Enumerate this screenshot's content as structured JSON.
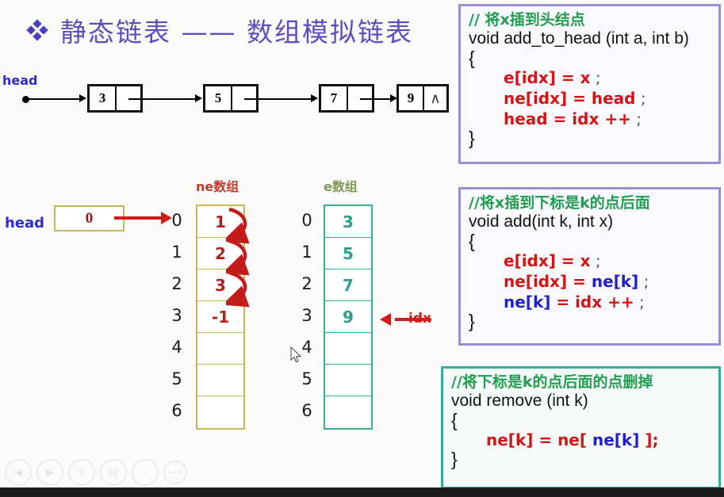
{
  "slide": {
    "title": "静态链表 —— 数组模拟链表",
    "bullet_icon": "diamond-bullet-icon"
  },
  "linked_list": {
    "head_label": "head",
    "nodes": [
      {
        "value": "3",
        "pointer": ""
      },
      {
        "value": "5",
        "pointer": ""
      },
      {
        "value": "7",
        "pointer": ""
      },
      {
        "value": "9",
        "pointer": "∧"
      }
    ]
  },
  "arrays": {
    "head_label": "head",
    "head_value": "0",
    "ne_title": "ne数组",
    "e_title": "e数组",
    "indices": [
      "0",
      "1",
      "2",
      "3",
      "4",
      "5",
      "6"
    ],
    "ne_values": [
      "1",
      "2",
      "3",
      "-1",
      "",
      "",
      ""
    ],
    "e_values": [
      "3",
      "5",
      "7",
      "9",
      "",
      "",
      ""
    ],
    "idx_label": "idx"
  },
  "code_boxes": [
    {
      "comment": "// 将x插到头结点",
      "signature": "void add_to_head (int a, int b)",
      "open_brace": "{",
      "close_brace": "}",
      "statements": [
        {
          "parts": [
            {
              "t": "e[idx] = x",
              "c": "r"
            },
            {
              "t": " ;",
              "c": "k"
            }
          ]
        },
        {
          "parts": [
            {
              "t": "ne[idx] = head",
              "c": "r"
            },
            {
              "t": " ;",
              "c": "k"
            }
          ]
        },
        {
          "parts": [
            {
              "t": " head = idx ++",
              "c": "r"
            },
            {
              "t": " ;",
              "c": "k"
            }
          ]
        }
      ]
    },
    {
      "comment": "//将x插到下标是k的点后面",
      "signature": "void add(int k,  int x)",
      "open_brace": "{",
      "close_brace": "}",
      "statements": [
        {
          "parts": [
            {
              "t": "e[idx] = x",
              "c": "r"
            },
            {
              "t": " ;",
              "c": "k"
            }
          ]
        },
        {
          "parts": [
            {
              "t": "ne[idx] = ",
              "c": "r"
            },
            {
              "t": "ne[k]",
              "c": "b"
            },
            {
              "t": " ;",
              "c": "k"
            }
          ]
        },
        {
          "parts": [
            {
              "t": "ne[k]",
              "c": "b"
            },
            {
              "t": " = idx ++",
              "c": "r"
            },
            {
              "t": " ;",
              "c": "k"
            }
          ]
        }
      ]
    },
    {
      "comment": "//将下标是k的点后面的点删掉",
      "signature": "void remove (int k)",
      "open_brace": "{",
      "close_brace": "}",
      "statements": [
        {
          "parts": [
            {
              "t": "ne[k] = ne[ ",
              "c": "r"
            },
            {
              "t": "ne[k]",
              "c": "b"
            },
            {
              "t": " ];",
              "c": "r"
            }
          ]
        }
      ]
    }
  ],
  "toolbar": {
    "buttons": [
      {
        "icon": "previous-slide-icon",
        "glyph": "◀"
      },
      {
        "icon": "next-slide-icon",
        "glyph": "▶"
      },
      {
        "icon": "pen-annotate-icon",
        "glyph": "✎"
      },
      {
        "icon": "slide-grid-icon",
        "glyph": "▤"
      },
      {
        "icon": "zoom-magnifier-icon",
        "glyph": "⌕"
      },
      {
        "icon": "more-options-icon",
        "glyph": "•••"
      }
    ]
  },
  "colors": {
    "title": "#5b4fbe",
    "head_blue": "#2b2bd4",
    "ne_red": "#b02020",
    "e_teal": "#2f9e8a",
    "arrow_red": "#d01b1b",
    "comment_green": "#1f9e4f",
    "code_red": "#d41414",
    "code_blue": "#2020c8",
    "box_purple": "#9b90d4",
    "box_teal": "#3aab96"
  }
}
